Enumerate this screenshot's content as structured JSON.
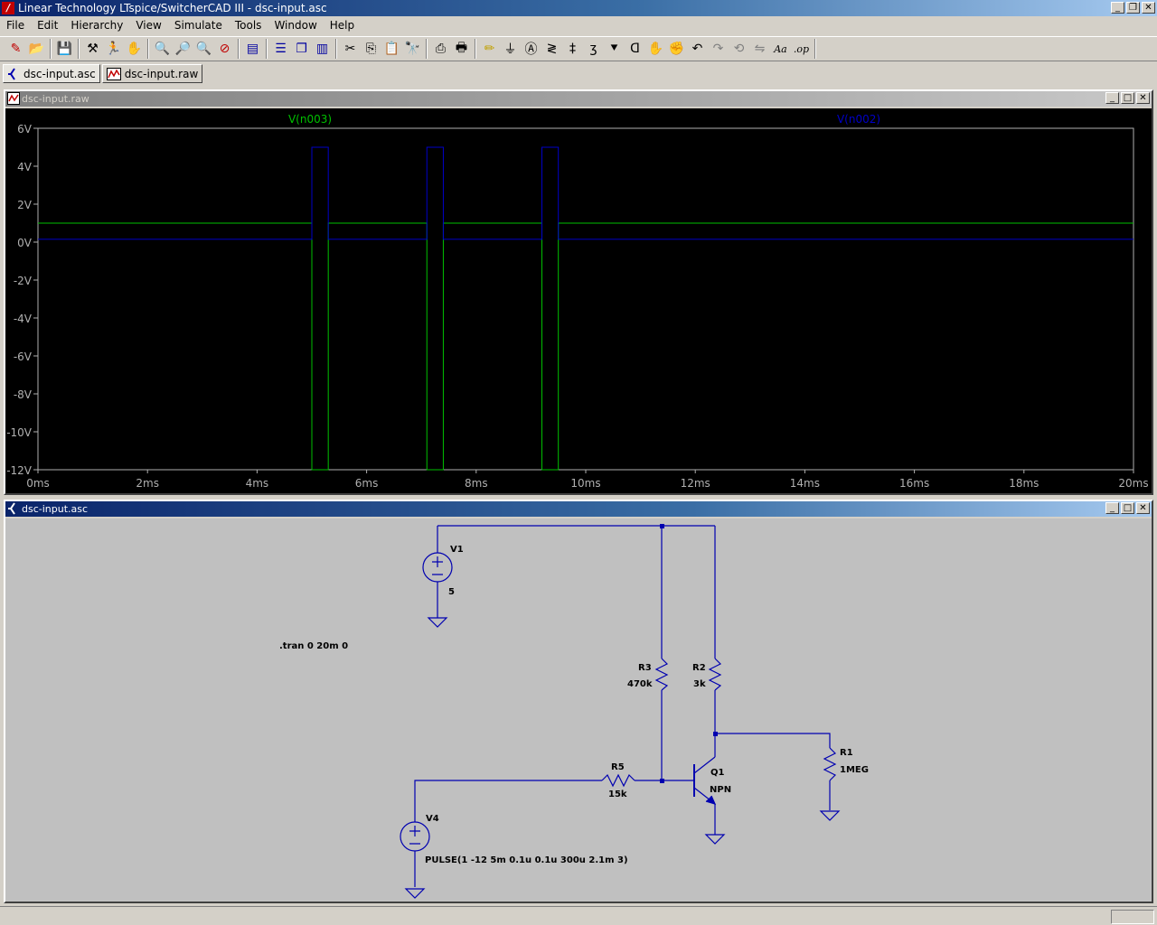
{
  "window": {
    "app_icon": "ltspice-logo-icon",
    "title": "Linear Technology LTspice/SwitcherCAD III - dsc-input.asc",
    "buttons": [
      "minimize-icon",
      "restore-icon",
      "close-icon"
    ]
  },
  "menu": [
    "File",
    "Edit",
    "Hierarchy",
    "View",
    "Simulate",
    "Tools",
    "Window",
    "Help"
  ],
  "toolbar": {
    "groups": [
      [
        "new-schematic-icon",
        "open-icon"
      ],
      [
        "save-icon"
      ],
      [
        "control-panel-icon",
        "run-icon",
        "halt-icon"
      ],
      [
        "zoom-in-icon",
        "pan-icon",
        "zoom-out-icon",
        "zoom-fit-icon"
      ],
      [
        "autorange-icon"
      ],
      [
        "tile-horizontal-icon",
        "cascade-icon",
        "tile-vertical-icon"
      ],
      [
        "cut-icon",
        "copy-icon",
        "paste-icon",
        "find-icon"
      ],
      [
        "print-setup-icon",
        "print-icon"
      ],
      [
        "draw-wire-icon",
        "ground-icon",
        "label-net-icon",
        "resistor-icon",
        "capacitor-icon",
        "inductor-icon",
        "diode-icon",
        "component-icon",
        "move-icon",
        "drag-icon",
        "undo-icon",
        "redo-icon",
        "rotate-icon",
        "mirror-icon",
        "text-icon",
        "spice-directive-icon"
      ]
    ],
    "text_button": "Aa",
    "op_button": ".op"
  },
  "tabs": [
    {
      "label": "dsc-input.asc",
      "icon": "schematic-icon",
      "active": true
    },
    {
      "label": "dsc-input.raw",
      "icon": "waveform-icon",
      "active": false
    }
  ],
  "plot_window": {
    "title": "dsc-input.raw",
    "active": false
  },
  "schematic_window": {
    "title": "dsc-input.asc",
    "active": true,
    "components": {
      "v1": {
        "name": "V1",
        "value": "5"
      },
      "v4": {
        "name": "V4",
        "value": "PULSE(1 -12 5m 0.1u 0.1u 300u 2.1m 3)"
      },
      "r1": {
        "name": "R1",
        "value": "1MEG"
      },
      "r2": {
        "name": "R2",
        "value": "3k"
      },
      "r3": {
        "name": "R3",
        "value": "470k"
      },
      "r5": {
        "name": "R5",
        "value": "15k"
      },
      "q1": {
        "name": "Q1",
        "value": "NPN"
      }
    },
    "directive": ".tran 0 20m 0"
  },
  "colors": {
    "v_n003": "#00c000",
    "v_n002": "#0000c8",
    "wire": "#0000b0",
    "schematic_bg": "#c0c0c0",
    "plot_bg": "#000000",
    "plot_axis": "#b0b0b0"
  },
  "chart_data": {
    "type": "line",
    "title": "",
    "xlabel": "",
    "ylabel": "",
    "xlim": [
      0,
      20
    ],
    "ylim": [
      -12,
      6
    ],
    "x_ticks": [
      "0ms",
      "2ms",
      "4ms",
      "6ms",
      "8ms",
      "10ms",
      "12ms",
      "14ms",
      "16ms",
      "18ms",
      "20ms"
    ],
    "y_ticks": [
      "6V",
      "4V",
      "2V",
      "0V",
      "-2V",
      "-4V",
      "-6V",
      "-8V",
      "-10V",
      "-12V"
    ],
    "x_tick_values": [
      0,
      2,
      4,
      6,
      8,
      10,
      12,
      14,
      16,
      18,
      20
    ],
    "y_tick_values": [
      6,
      4,
      2,
      0,
      -2,
      -4,
      -6,
      -8,
      -10,
      -12
    ],
    "grid": false,
    "series": [
      {
        "name": "V(n003)",
        "color": "#00c000",
        "x": [
          0,
          5.0,
          5.0,
          5.3,
          5.3,
          7.1,
          7.1,
          7.4,
          7.4,
          9.2,
          9.2,
          9.5,
          9.5,
          20
        ],
        "y": [
          1,
          1,
          -12,
          -12,
          1,
          1,
          -12,
          -12,
          1,
          1,
          -12,
          -12,
          1,
          1
        ]
      },
      {
        "name": "V(n002)",
        "color": "#0000c8",
        "x": [
          0,
          5.0,
          5.0,
          5.3,
          5.3,
          7.1,
          7.1,
          7.4,
          7.4,
          9.2,
          9.2,
          9.5,
          9.5,
          20
        ],
        "y": [
          0.15,
          0.15,
          5,
          5,
          0.15,
          0.15,
          5,
          5,
          0.15,
          0.15,
          5,
          5,
          0.15,
          0.15
        ]
      }
    ]
  }
}
